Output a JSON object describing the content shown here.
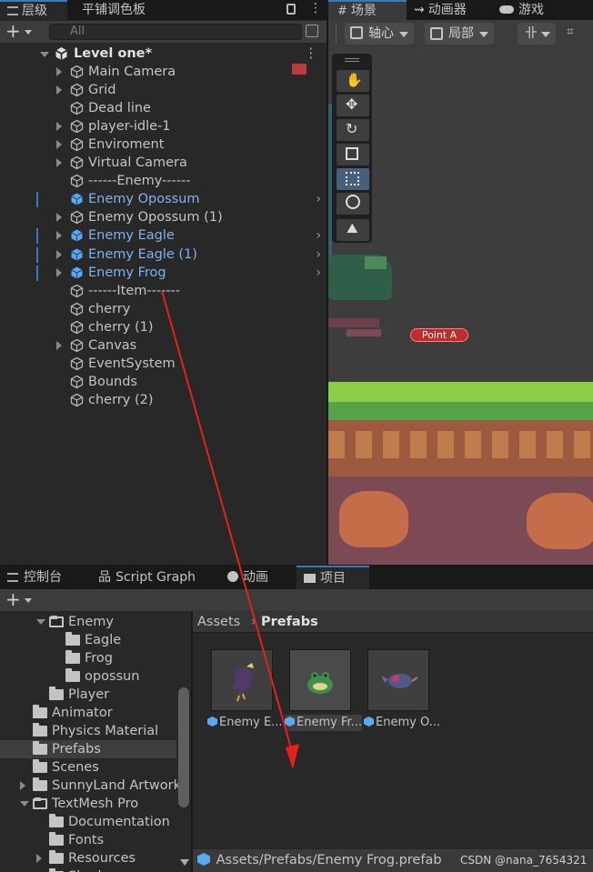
{
  "hierarchy": {
    "tabs": [
      "层级",
      "平铺调色板"
    ],
    "search_placeholder": "All",
    "scene_name": "Level one*",
    "items": [
      {
        "label": "Main Camera",
        "expandable": true,
        "prefab": false
      },
      {
        "label": "Grid",
        "expandable": true,
        "prefab": false
      },
      {
        "label": "Dead line",
        "expandable": false,
        "prefab": false
      },
      {
        "label": "player-idle-1",
        "expandable": true,
        "prefab": false
      },
      {
        "label": "Enviroment",
        "expandable": true,
        "prefab": false
      },
      {
        "label": "Virtual Camera",
        "expandable": true,
        "prefab": false
      },
      {
        "label": "------Enemy------",
        "expandable": false,
        "prefab": false
      },
      {
        "label": "Enemy Opossum",
        "expandable": false,
        "prefab": true
      },
      {
        "label": "Enemy Opossum (1)",
        "expandable": true,
        "prefab": false
      },
      {
        "label": "Enemy Eagle",
        "expandable": true,
        "prefab": true
      },
      {
        "label": "Enemy Eagle (1)",
        "expandable": true,
        "prefab": true
      },
      {
        "label": "Enemy Frog",
        "expandable": true,
        "prefab": true
      },
      {
        "label": "------Item-------",
        "expandable": false,
        "prefab": false
      },
      {
        "label": "cherry",
        "expandable": false,
        "prefab": false
      },
      {
        "label": "cherry (1)",
        "expandable": false,
        "prefab": false
      },
      {
        "label": "Canvas",
        "expandable": true,
        "prefab": false
      },
      {
        "label": "EventSystem",
        "expandable": false,
        "prefab": false
      },
      {
        "label": "Bounds",
        "expandable": false,
        "prefab": false
      },
      {
        "label": "cherry (2)",
        "expandable": false,
        "prefab": false
      }
    ]
  },
  "scene": {
    "tabs": [
      "场景",
      "动画器",
      "游戏"
    ],
    "pivot_label": "轴心",
    "space_label": "局部",
    "point_label": "Point A"
  },
  "bottom": {
    "tabs": [
      "控制台",
      "Script Graph",
      "动画",
      "项目"
    ],
    "tree": [
      {
        "label": "Enemy",
        "indent": 2,
        "arrow": "down",
        "open": true
      },
      {
        "label": "Eagle",
        "indent": 3,
        "arrow": "none",
        "open": false
      },
      {
        "label": "Frog",
        "indent": 3,
        "arrow": "none",
        "open": false
      },
      {
        "label": "opossun",
        "indent": 3,
        "arrow": "none",
        "open": false
      },
      {
        "label": "Player",
        "indent": 2,
        "arrow": "none",
        "open": false
      },
      {
        "label": "Animator",
        "indent": 1,
        "arrow": "none",
        "open": false
      },
      {
        "label": "Physics Material",
        "indent": 1,
        "arrow": "none",
        "open": false
      },
      {
        "label": "Prefabs",
        "indent": 1,
        "arrow": "none",
        "open": false,
        "selected": true
      },
      {
        "label": "Scenes",
        "indent": 1,
        "arrow": "none",
        "open": false
      },
      {
        "label": "SunnyLand Artwork",
        "indent": 1,
        "arrow": "right",
        "open": false
      },
      {
        "label": "TextMesh Pro",
        "indent": 1,
        "arrow": "down",
        "open": true
      },
      {
        "label": "Documentation",
        "indent": 2,
        "arrow": "none",
        "open": false
      },
      {
        "label": "Fonts",
        "indent": 2,
        "arrow": "none",
        "open": false
      },
      {
        "label": "Resources",
        "indent": 2,
        "arrow": "right",
        "open": false
      },
      {
        "label": "Shaders",
        "indent": 2,
        "arrow": "none",
        "open": false
      }
    ],
    "breadcrumb": {
      "root": "Assets",
      "current": "Prefabs"
    },
    "assets": [
      {
        "label": "Enemy E...",
        "selected": false
      },
      {
        "label": "Enemy Fr...",
        "selected": true
      },
      {
        "label": "Enemy O...",
        "selected": false
      }
    ],
    "status_path": "Assets/Prefabs/Enemy Frog.prefab",
    "watermark": "CSDN @nana_7654321"
  }
}
